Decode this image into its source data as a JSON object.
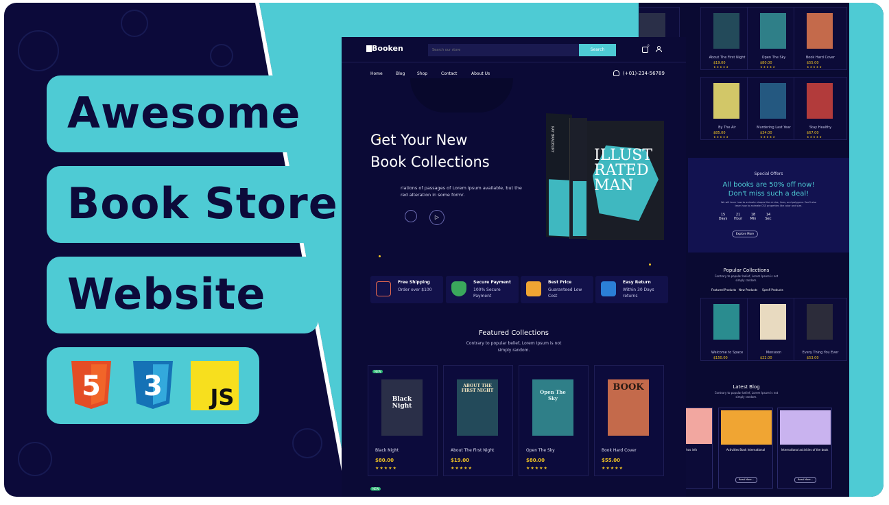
{
  "headline": {
    "line1": "Awesome",
    "line2": "Book Store",
    "line3": "Website"
  },
  "tech_icons": [
    {
      "name": "html5-icon",
      "label": "5"
    },
    {
      "name": "css3-icon",
      "label": "3"
    },
    {
      "name": "javascript-icon",
      "label": "JS"
    }
  ],
  "nav": {
    "logo": "Booken",
    "search_placeholder": "Search our store",
    "search_button": "Search",
    "cart_count": "0",
    "links": [
      "Home",
      "Blog",
      "Shop",
      "Contact",
      "About Us"
    ],
    "phone": "(+01)-234-56789"
  },
  "hero": {
    "title_line1": "Get Your New",
    "title_line2": "Book Collections",
    "desc_line1": "riations of passages of Lorem Ipsum available, but the",
    "desc_line2": "red alteration in some formr."
  },
  "features": [
    {
      "title": "Free Shipping",
      "sub": "Order over $100"
    },
    {
      "title": "Secure Payment",
      "sub": "100% Secure Payment"
    },
    {
      "title": "Best Price",
      "sub": "Guaranteed Low Cost"
    },
    {
      "title": "Easy Return",
      "sub": "Within 30 Days returns"
    }
  ],
  "featured": {
    "title": "Featured Collections",
    "subtitle_line1": "Contrary to popular belief, Lorem Ipsum is not",
    "subtitle_line2": "simply random.",
    "badge": "NEW",
    "books": [
      {
        "title": "Black Night",
        "price": "$80.00",
        "cover": "Black Night",
        "color": "#2a2f48"
      },
      {
        "title": "About The First Night",
        "price": "$19.00",
        "cover": "ABOUT THE FIRST NIGHT",
        "color": "#234a5a"
      },
      {
        "title": "Open The Sky",
        "price": "$80.00",
        "cover": "Open The Sky",
        "color": "#2f7f88"
      },
      {
        "title": "Book Hard Cover",
        "price": "$55.00",
        "cover": "BOOK",
        "color": "#c46a4b"
      }
    ],
    "stars": "★★★★★"
  },
  "hero_book": {
    "spine": "RAY BRADBURY",
    "cover": "ILLUST RATED MAN"
  },
  "back_page": {
    "top_books": [
      {
        "title": "About The First Night",
        "price": "$19.00",
        "color": "#234a5a"
      },
      {
        "title": "Open The Sky",
        "price": "$80.00",
        "color": "#2f7f88"
      },
      {
        "title": "Book Hard Cover",
        "price": "$55.00",
        "color": "#c46a4b"
      }
    ],
    "row2_books": [
      {
        "title": "By The Air",
        "price": "$85.00",
        "color": "#d2c768"
      },
      {
        "title": "Murdering Last Year",
        "price": "$34.00",
        "color": "#245880"
      },
      {
        "title": "Stay Healthy",
        "price": "$67.00",
        "color": "#b23b3b"
      }
    ],
    "special": {
      "label": "Special Offers",
      "headline1": "All books are 50% off now!",
      "headline2": "Don't miss such a deal!",
      "desc_line1": "We will learn how to animate shapes like circles, lines, and polygons. You'll also",
      "desc_line2": "learn how to animate CSS properties like color and size.",
      "countdown": [
        {
          "v": "15",
          "u": "Days"
        },
        {
          "v": "21",
          "u": "Hour"
        },
        {
          "v": "18",
          "u": "Min"
        },
        {
          "v": "14",
          "u": "Sec"
        }
      ],
      "button": "Explore More"
    },
    "popular": {
      "title": "Popular Collections",
      "sub_line1": "Contrary to popular belief, Lorem Ipsum is not",
      "sub_line2": "simply random.",
      "tabs": [
        "Featured Products",
        "New Products",
        "Spesfl Products"
      ],
      "books": [
        {
          "title": "Welcome to Space",
          "price": "$150.00",
          "color": "#2a8c8f"
        },
        {
          "title": "Monsoon",
          "price": "$22.00",
          "color": "#e8dac0"
        },
        {
          "title": "Every Thing You Ever",
          "price": "$53.00",
          "color": "#2c2c3a"
        }
      ]
    },
    "blog": {
      "title": "Latest Blog",
      "sub_line1": "Contrary to popular belief, Lorem Ipsum is not",
      "sub_line2": "simply random.",
      "posts": [
        {
          "title": "ng has info",
          "color": "#f2a7a0"
        },
        {
          "title": "Activities Book International",
          "color": "#f0a533"
        },
        {
          "title": "International activities of the book",
          "color": "#c9b3ef"
        }
      ],
      "read_more": "Read More..."
    }
  },
  "colors": {
    "accent": "#4ecbd4",
    "navy": "#0c0a3a",
    "star": "#f3c623"
  }
}
